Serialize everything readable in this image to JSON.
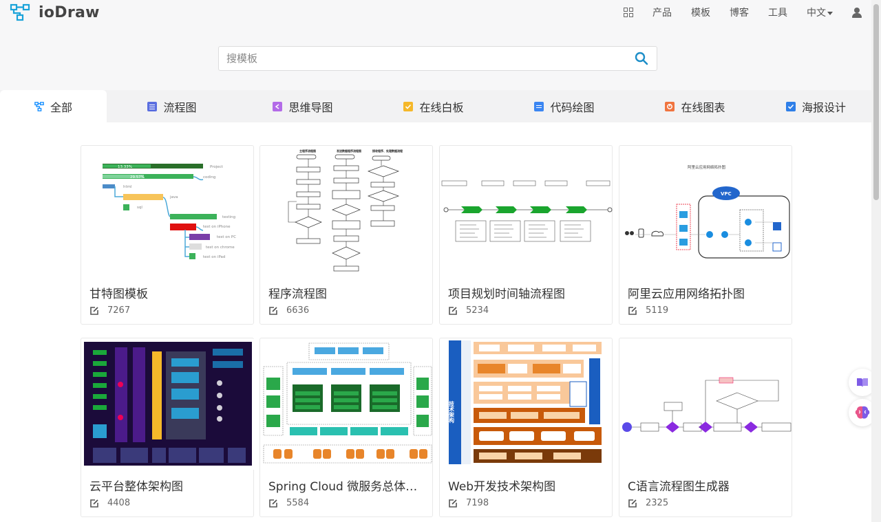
{
  "header": {
    "app_name": "ioDraw",
    "nav": [
      {
        "label": "产品"
      },
      {
        "label": "模板"
      },
      {
        "label": "博客"
      },
      {
        "label": "工具"
      },
      {
        "label": "中文"
      }
    ]
  },
  "search": {
    "placeholder": "搜模板"
  },
  "tabs": [
    {
      "label": "全部",
      "icon": "flowchart-icon",
      "color": "#1890ff",
      "active": true
    },
    {
      "label": "流程图",
      "icon": "flow-doc-icon",
      "color": "#5b6fe0"
    },
    {
      "label": "思维导图",
      "icon": "mindmap-icon",
      "color": "#b36be8"
    },
    {
      "label": "在线白板",
      "icon": "whiteboard-icon",
      "color": "#f5b82a"
    },
    {
      "label": "代码绘图",
      "icon": "code-doc-icon",
      "color": "#3b86f2"
    },
    {
      "label": "在线图表",
      "icon": "chart-icon",
      "color": "#f0743f"
    },
    {
      "label": "海报设计",
      "icon": "poster-check-icon",
      "color": "#2f7fe8"
    }
  ],
  "templates": [
    {
      "title": "甘特图模板",
      "count": "7267"
    },
    {
      "title": "程序流程图",
      "count": "6636"
    },
    {
      "title": "项目规划时间轴流程图",
      "count": "5234"
    },
    {
      "title": "阿里云应用网络拓扑图",
      "count": "5119"
    },
    {
      "title": "云平台整体架构图",
      "count": "4408"
    },
    {
      "title": "Spring Cloud 微服务总体架构图",
      "count": "5584"
    },
    {
      "title": "Web开发技术架构图",
      "count": "7198"
    },
    {
      "title": "C语言流程图生成器",
      "count": "2325"
    }
  ]
}
